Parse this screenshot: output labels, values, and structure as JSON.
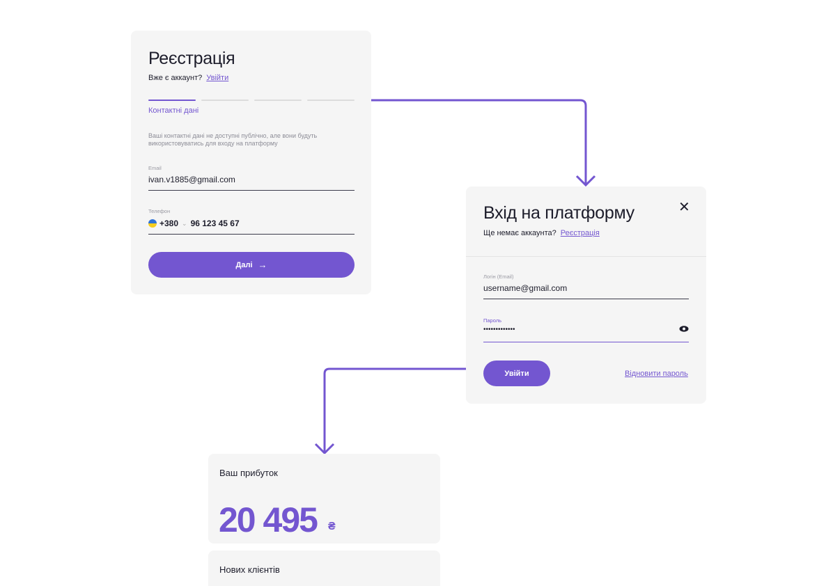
{
  "registration": {
    "title": "Реєстрація",
    "have_account": "Вже є аккаунт?",
    "login_link": "Увійти",
    "step_label": "Контактні дані",
    "description": "Ваші контактні дані не доступні публічно, але вони будуть використовуватись для входу на платформу",
    "email_label": "Email",
    "email_value": "ivan.v1885@gmail.com",
    "phone_label": "Телефон",
    "phone_code": "+380",
    "phone_value": "96 123 45 67",
    "next_button": "Далі",
    "steps_total": 4,
    "steps_active": 1
  },
  "login": {
    "title": "Вхід на платформу",
    "no_account": "Ще немає аккаунта?",
    "register_link": "Реєстрація",
    "login_label": "Логін (Email)",
    "login_value": "username@gmail.com",
    "password_label": "Пароль",
    "password_value": "•••••••••••••",
    "submit_button": "Увійти",
    "recover_link": "Відновити пароль"
  },
  "stats": {
    "profit_label": "Ваш прибуток",
    "profit_value": "20 495",
    "profit_currency": "₴",
    "clients_label": "Нових клієнтів"
  },
  "colors": {
    "accent": "#7356d0",
    "card_bg": "#f5f5f5",
    "text": "#1d1d2b"
  },
  "icons": {
    "close": "close-icon",
    "eye": "eye-icon",
    "arrow": "arrow-right-icon",
    "flag": "ukraine-flag-icon"
  }
}
